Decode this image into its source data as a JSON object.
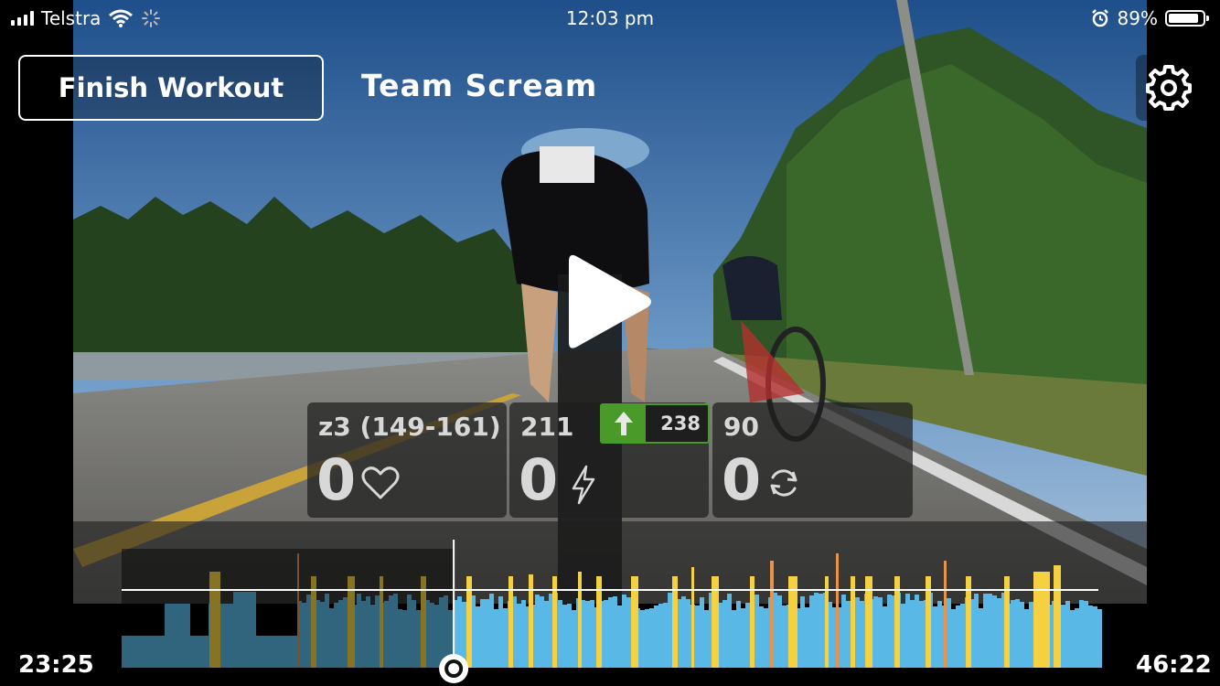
{
  "status_bar": {
    "carrier": "Telstra",
    "time": "12:03 pm",
    "battery": "89%",
    "battery_level": 0.89
  },
  "header": {
    "finish_label": "Finish Workout",
    "title": "Team Scream"
  },
  "icons": {
    "settings": "gear-icon",
    "play": "play-icon",
    "heart": "heart-icon",
    "power": "lightning-icon",
    "cadence": "refresh-icon",
    "ftp_up": "arrow-up-icon"
  },
  "metrics": {
    "heart_rate": {
      "target": "z3 (149-161)",
      "value": "0"
    },
    "power": {
      "target": "211",
      "value": "0",
      "ftp": "238"
    },
    "cadence": {
      "target": "90",
      "value": "0"
    }
  },
  "timeline": {
    "elapsed": "23:25",
    "total": "46:22",
    "progress": 0.34
  },
  "colors": {
    "zone_blue": "#5ab8e6",
    "zone_yellow": "#f5d142",
    "zone_orange": "#e8924a",
    "ftp_green": "#4a9a2a"
  }
}
